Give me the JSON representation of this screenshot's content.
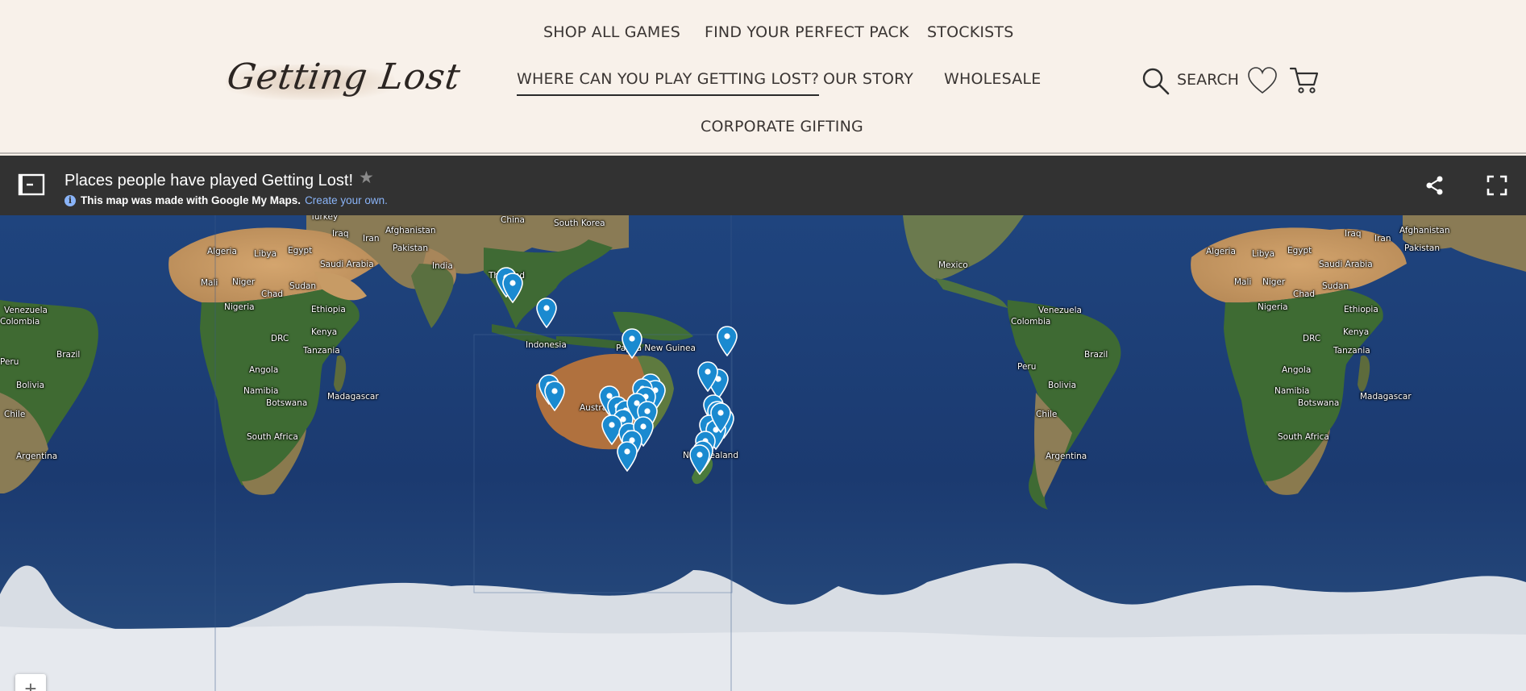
{
  "header": {
    "logo_text": "Getting Lost",
    "nav": [
      {
        "label": "SHOP ALL GAMES",
        "active": false
      },
      {
        "label": "FIND YOUR PERFECT PACK",
        "active": false
      },
      {
        "label": "STOCKISTS",
        "active": false
      },
      {
        "label": "WHERE CAN YOU PLAY GETTING LOST?",
        "active": true
      },
      {
        "label": "OUR STORY",
        "active": false
      },
      {
        "label": "WHOLESALE",
        "active": false
      },
      {
        "label": "CORPORATE GIFTING",
        "active": false
      }
    ],
    "search_label": "SEARCH",
    "icons": {
      "search": "search-icon",
      "wishlist": "heart-icon",
      "cart": "cart-icon"
    }
  },
  "map_bar": {
    "title": "Places people have played Getting Lost!",
    "star": "★",
    "note_text": "This map was made with Google My Maps.",
    "note_link": "Create your own.",
    "icons": {
      "panel": "panel-toggle-icon",
      "share": "share-icon",
      "fullscreen": "fullscreen-icon"
    }
  },
  "map": {
    "labels": [
      "Turkey",
      "Iraq",
      "Iran",
      "Afghanistan",
      "China",
      "South Korea",
      "Algeria",
      "Libya",
      "Egypt",
      "Saudi Arabia",
      "Pakistan",
      "India",
      "Mali",
      "Niger",
      "Chad",
      "Sudan",
      "Thailand",
      "Nigeria",
      "Ethiopia",
      "Venezuela",
      "Colombia",
      "DRC",
      "Kenya",
      "Tanzania",
      "Indonesia",
      "Papua New Guinea",
      "Brazil",
      "Angola",
      "Peru",
      "Bolivia",
      "Namibia",
      "Botswana",
      "Madagascar",
      "Australia",
      "Chile",
      "South Africa",
      "Argentina",
      "New Zealand",
      "Mexico"
    ],
    "zoom_in": "+",
    "colors": {
      "pin": "#1a8ad0",
      "ocean": "#1d3f7a",
      "ice": "#d9dee4"
    }
  }
}
